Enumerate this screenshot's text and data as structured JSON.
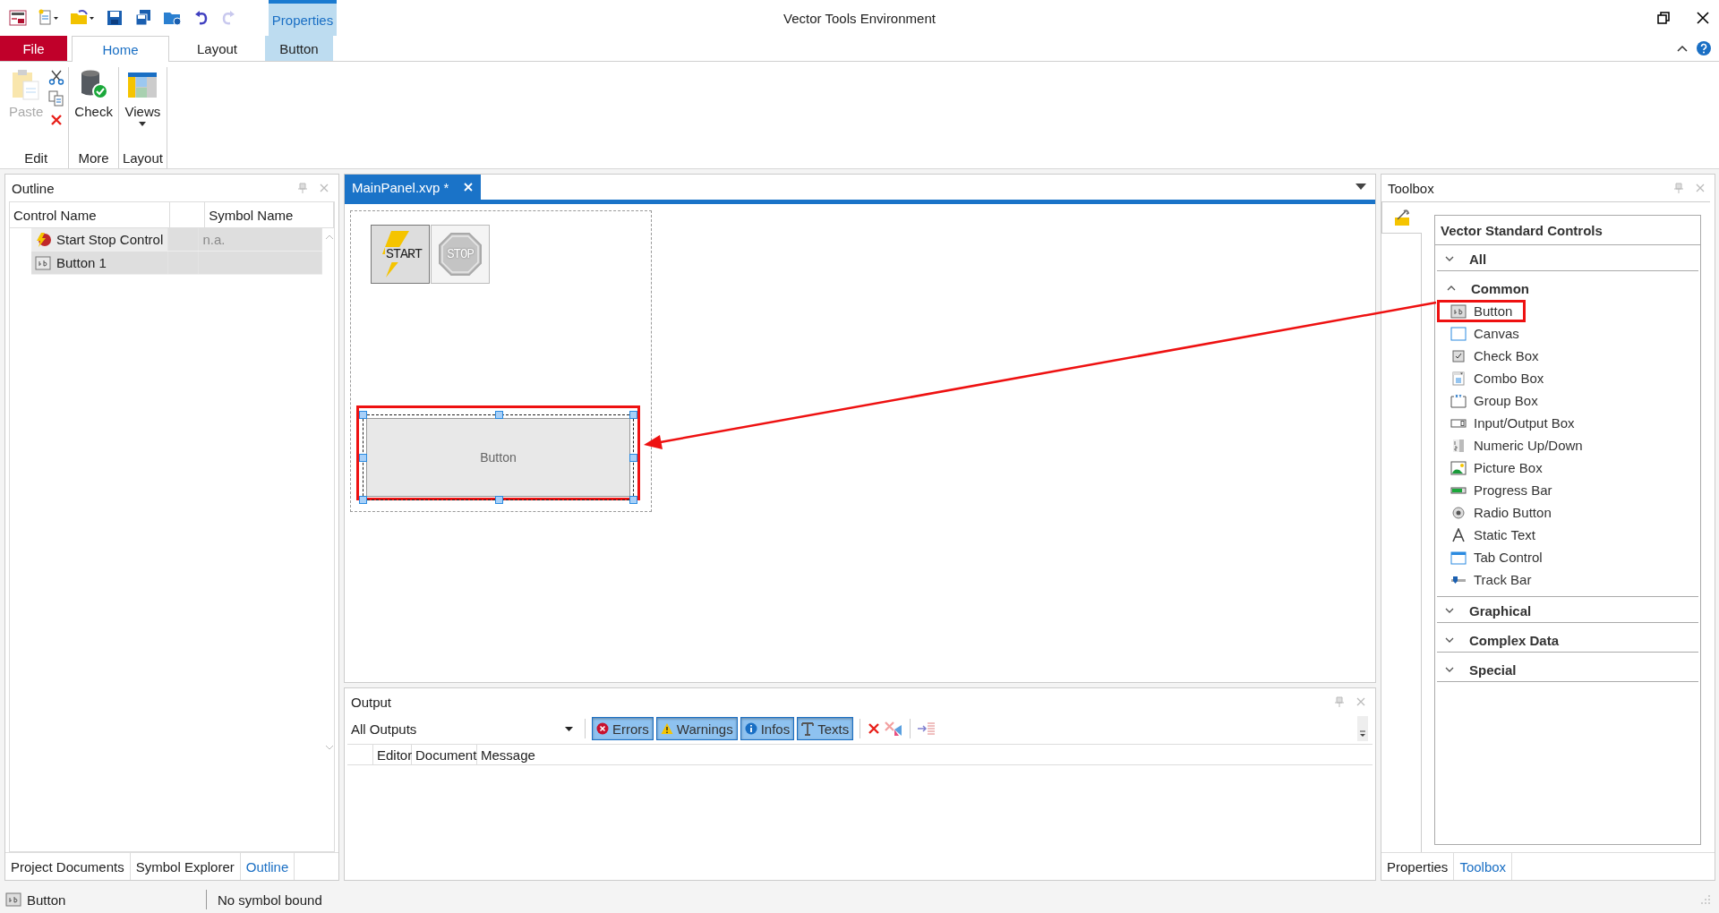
{
  "window": {
    "title": "Vector Tools Environment"
  },
  "ribbon": {
    "context_header": "Properties",
    "tabs": [
      {
        "label": "File",
        "kind": "file",
        "selected": false
      },
      {
        "label": "Home",
        "kind": "normal",
        "selected": true
      },
      {
        "label": "Layout",
        "kind": "normal",
        "selected": false
      },
      {
        "label": "Button",
        "kind": "context",
        "selected": false
      }
    ],
    "groups": [
      {
        "label": "Edit",
        "buttons": [
          {
            "label": "Paste",
            "kind": "paste",
            "disabled": true
          }
        ]
      },
      {
        "label": "More",
        "buttons": [
          {
            "label": "Check",
            "kind": "check",
            "disabled": false
          }
        ]
      },
      {
        "label": "Layout",
        "buttons": [
          {
            "label": "Views",
            "kind": "views",
            "disabled": false
          }
        ]
      }
    ]
  },
  "outline": {
    "title": "Outline",
    "columns": [
      "Control Name",
      "Symbol Name"
    ],
    "rows": [
      {
        "name": "Start Stop Control",
        "symbol": "n.a.",
        "kind": "startstop",
        "selected": false
      },
      {
        "name": "Button 1",
        "symbol": "",
        "kind": "button",
        "selected": true
      }
    ],
    "tabs": [
      {
        "label": "Project Documents",
        "selected": false
      },
      {
        "label": "Symbol Explorer",
        "selected": false
      },
      {
        "label": "Outline",
        "selected": true
      }
    ]
  },
  "editor": {
    "tab": {
      "label": "MainPanel.xvp *",
      "selected": true
    },
    "canvas": {
      "start_label": "START",
      "stop_label": "STOP",
      "button_label": "Button",
      "button_selected": true
    }
  },
  "output": {
    "title": "Output",
    "source": "All Outputs",
    "filters": [
      {
        "label": "Errors",
        "kind": "error",
        "selected": true
      },
      {
        "label": "Warnings",
        "kind": "warning",
        "selected": true
      },
      {
        "label": "Infos",
        "kind": "info",
        "selected": true
      },
      {
        "label": "Texts",
        "kind": "text",
        "selected": true
      }
    ],
    "columns": [
      "Editor",
      "Document",
      "Message"
    ]
  },
  "toolbox": {
    "title": "Toolbox",
    "heading": "Vector Standard Controls",
    "categories": [
      {
        "label": "All",
        "expanded": false
      },
      {
        "label": "Common",
        "expanded": true,
        "items": [
          {
            "label": "Button",
            "kind": "button",
            "selected": true
          },
          {
            "label": "Canvas",
            "kind": "canvas",
            "selected": false
          },
          {
            "label": "Check Box",
            "kind": "checkbox",
            "selected": false
          },
          {
            "label": "Combo Box",
            "kind": "combobox",
            "selected": false
          },
          {
            "label": "Group Box",
            "kind": "groupbox",
            "selected": false
          },
          {
            "label": "Input/Output Box",
            "kind": "io",
            "selected": false
          },
          {
            "label": "Numeric Up/Down",
            "kind": "numeric",
            "selected": false
          },
          {
            "label": "Picture Box",
            "kind": "picture",
            "selected": false
          },
          {
            "label": "Progress Bar",
            "kind": "progress",
            "selected": false
          },
          {
            "label": "Radio Button",
            "kind": "radio",
            "selected": false
          },
          {
            "label": "Static Text",
            "kind": "static",
            "selected": false
          },
          {
            "label": "Tab Control",
            "kind": "tab",
            "selected": false
          },
          {
            "label": "Track Bar",
            "kind": "track",
            "selected": false
          }
        ]
      },
      {
        "label": "Graphical",
        "expanded": false
      },
      {
        "label": "Complex Data",
        "expanded": false
      },
      {
        "label": "Special",
        "expanded": false
      }
    ],
    "tabs": [
      {
        "label": "Properties",
        "selected": false
      },
      {
        "label": "Toolbox",
        "selected": true
      }
    ]
  },
  "status_bar": {
    "control": "Button",
    "symbol": "No symbol bound"
  }
}
